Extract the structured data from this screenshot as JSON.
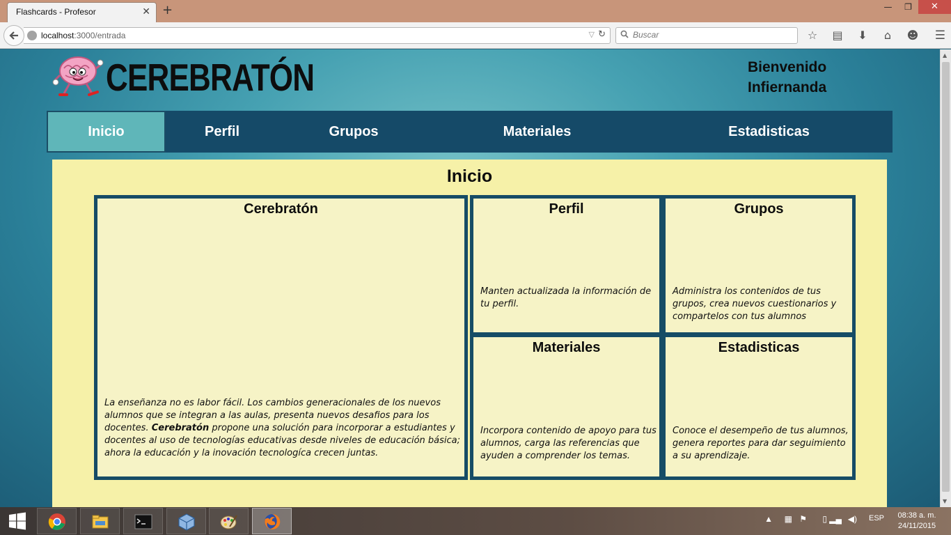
{
  "browser": {
    "tab_title": "Flashcards - Profesor",
    "tab_close": "✕",
    "new_tab": "+",
    "url_host": "localhost",
    "url_rest": ":3000/entrada",
    "search_placeholder": "Buscar"
  },
  "site": {
    "title": "CEREBRATÓN",
    "welcome_line1": "Bienvenido",
    "welcome_line2": "Infiernanda",
    "nav": [
      {
        "label": "Inicio",
        "active": true
      },
      {
        "label": "Perfil"
      },
      {
        "label": "Grupos"
      },
      {
        "label": "Materiales"
      },
      {
        "label": "Estadisticas"
      }
    ]
  },
  "main": {
    "heading": "Inicio",
    "cards": {
      "cerebraton": {
        "title": "Cerebratón",
        "text_before": "La enseñanza no es labor fácil. Los cambios generacionales de los nuevos alumnos que se integran a las aulas, presenta nuevos desafios para los docentes. ",
        "text_bold": "Cerebratón",
        "text_after": " propone una solución para incorporar a estudiantes y docentes al uso de tecnologías educativas desde niveles de educación básica; ahora la educación y la inovación tecnologíca crecen juntas."
      },
      "perfil": {
        "title": "Perfil",
        "text": "Manten actualizada la información de tu perfil."
      },
      "grupos": {
        "title": "Grupos",
        "text": "Administra los contenidos de tus grupos, crea nuevos cuestionarios y compartelos con tus alumnos"
      },
      "materiales": {
        "title": "Materiales",
        "text": "Incorpora contenido de apoyo para tus alumnos, carga las referencias que ayuden a comprender los temas."
      },
      "estadisticas": {
        "title": "Estadisticas",
        "text": "Conoce el desempeño de tus alumnos, genera reportes para dar seguimiento a su aprendizaje."
      }
    }
  },
  "taskbar": {
    "apps": [
      "chrome-icon",
      "file-explorer-icon",
      "command-prompt-icon",
      "virtualbox-icon",
      "paint-icon",
      "firefox-icon"
    ],
    "language": "ESP",
    "time": "08:38 a. m.",
    "date": "24/11/2015"
  },
  "colors": {
    "nav_bg": "#154a68",
    "nav_active": "#5fb6b9",
    "panel_bg": "#f6f1a8",
    "card_border": "#164c66"
  }
}
